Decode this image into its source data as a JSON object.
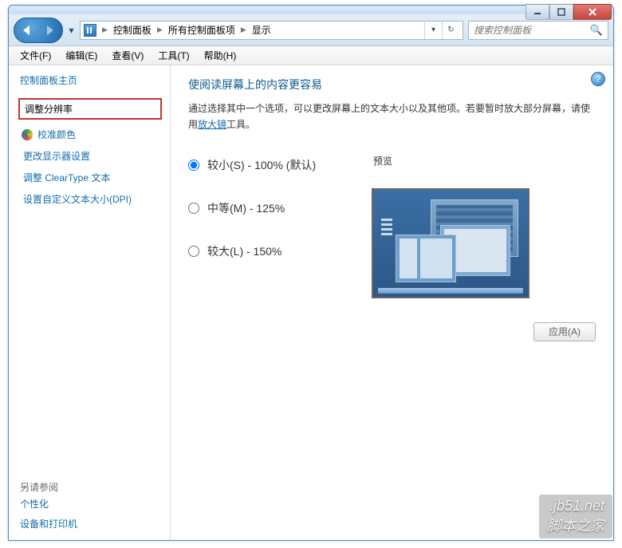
{
  "breadcrumb": {
    "root_sep": "▶",
    "items": [
      "控制面板",
      "所有控制面板项",
      "显示"
    ]
  },
  "search": {
    "placeholder": "搜索控制面板"
  },
  "menu": {
    "file": "文件(F)",
    "edit": "编辑(E)",
    "view": "查看(V)",
    "tools": "工具(T)",
    "help": "帮助(H)"
  },
  "sidebar": {
    "home": "控制面板主页",
    "selected": "调整分辨率",
    "calibrate": "校准颜色",
    "change_display": "更改显示器设置",
    "cleartype": "调整 ClearType 文本",
    "custom_dpi": "设置自定义文本大小(DPI)",
    "see_also_label": "另请参阅",
    "see_also": {
      "personalization": "个性化",
      "devices_printers": "设备和打印机"
    }
  },
  "main": {
    "heading": "使阅读屏幕上的内容更容易",
    "desc_pre": "通过选择其中一个选项，可以更改屏幕上的文本大小以及其他项。若要暂时放大部分屏幕，请使用",
    "desc_link": "放大镜",
    "desc_post": "工具。",
    "preview_label": "预览",
    "apply": "应用(A)",
    "options": {
      "small": "较小(S) - 100% (默认)",
      "medium": "中等(M) - 125%",
      "large": "较大(L) - 150%"
    }
  },
  "watermark": ".jb51.net\n脚本之家"
}
